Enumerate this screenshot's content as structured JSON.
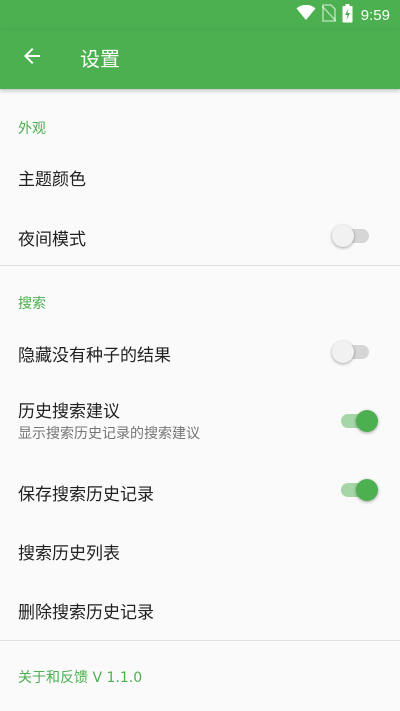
{
  "status_bar": {
    "time": "9:59",
    "icons": [
      "wifi-icon",
      "no-sim-icon",
      "battery-charging-icon"
    ]
  },
  "app_bar": {
    "title": "设置",
    "back_icon": "arrow-back-icon"
  },
  "colors": {
    "accent": "#4caf50",
    "switch_on_track": "#a5d6a7",
    "background": "#fafafa"
  },
  "sections": {
    "appearance": {
      "header": "外观",
      "theme_color": {
        "title": "主题颜色"
      },
      "night_mode": {
        "title": "夜间模式",
        "enabled": false
      }
    },
    "search": {
      "header": "搜索",
      "hide_no_seed": {
        "title": "隐藏没有种子的结果",
        "enabled": false
      },
      "history_suggestions": {
        "title": "历史搜索建议",
        "summary": "显示搜索历史记录的搜索建议",
        "enabled": true
      },
      "save_history": {
        "title": "保存搜索历史记录",
        "enabled": true
      },
      "history_list": {
        "title": "搜索历史列表"
      },
      "delete_history": {
        "title": "删除搜索历史记录"
      }
    },
    "about": {
      "header": "关于和反馈 V 1.1.0"
    }
  }
}
